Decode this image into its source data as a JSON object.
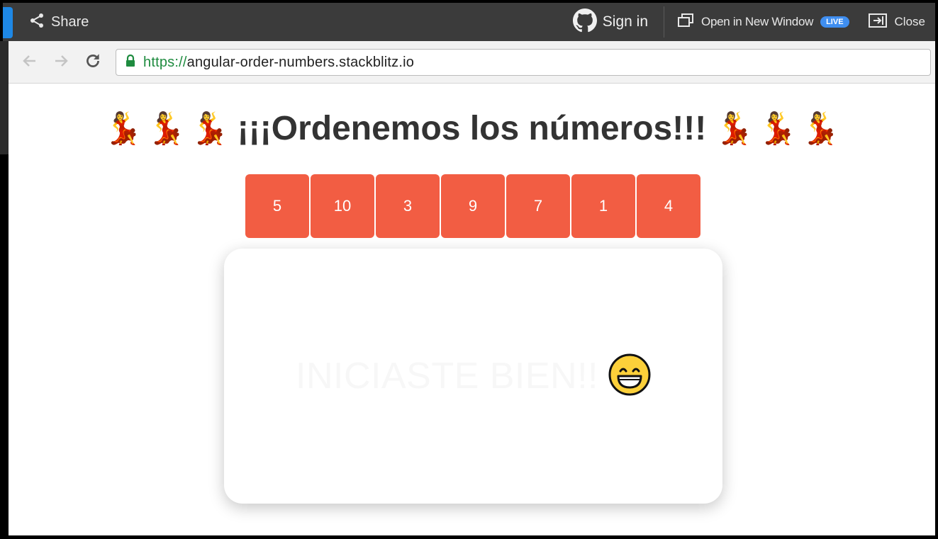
{
  "topbar": {
    "share_label": "Share",
    "signin_label": "Sign in",
    "open_window_label": "Open in New Window",
    "live_badge": "LIVE",
    "close_label": "Close"
  },
  "browser": {
    "url_protocol": "https://",
    "url_host": "angular-order-numbers.stackblitz.io"
  },
  "page": {
    "title": "¡¡¡Ordenemos los números!!!",
    "dancers_left": [
      "💃",
      "💃",
      "💃"
    ],
    "dancers_right": [
      "💃",
      "💃",
      "💃"
    ],
    "numbers": [
      "5",
      "10",
      "3",
      "9",
      "7",
      "1",
      "4"
    ],
    "card_message": "INICIASTE BIEN!!",
    "accent_color": "#f25d43"
  }
}
